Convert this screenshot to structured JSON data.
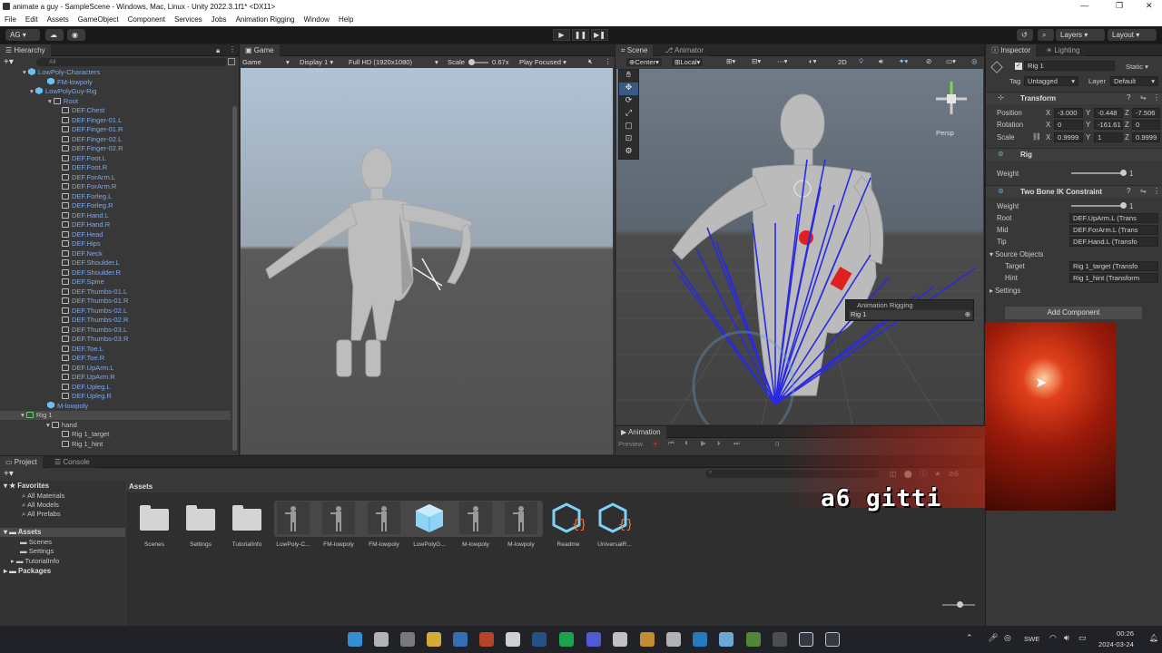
{
  "window": {
    "title": "animate a guy - SampleScene - Windows, Mac, Linux - Unity 2022.3.1f1* <DX11>",
    "controls": [
      "—",
      "❐",
      "✕"
    ]
  },
  "menu": [
    "File",
    "Edit",
    "Assets",
    "GameObject",
    "Component",
    "Services",
    "Jobs",
    "Animation Rigging",
    "Window",
    "Help"
  ],
  "toolbar": {
    "account": "AG",
    "layers": "Layers",
    "layout": "Layout"
  },
  "hierarchy": {
    "tab": "Hierarchy",
    "search": "All",
    "rows": [
      {
        "label": "LowPoly-Characters",
        "style": "blue"
      },
      {
        "label": "FM-lowpoly",
        "style": "blue"
      },
      {
        "label": "LowPolyGuy-Rig",
        "style": "blue"
      },
      {
        "label": "Root",
        "style": "blue"
      },
      {
        "label": "DEF.Chest",
        "style": "blue"
      },
      {
        "label": "DEF.Finger-01.L",
        "style": "blue"
      },
      {
        "label": "DEF.Finger-01.R",
        "style": "blue"
      },
      {
        "label": "DEF.Finger-02.L",
        "style": "blue"
      },
      {
        "label": "DEF.Finger-02.R",
        "style": "blue"
      },
      {
        "label": "DEF.Foot.L",
        "style": "blue"
      },
      {
        "label": "DEF.Foot.R",
        "style": "blue"
      },
      {
        "label": "DEF.ForArm.L",
        "style": "blue"
      },
      {
        "label": "DEF.ForArm.R",
        "style": "blue"
      },
      {
        "label": "DEF.Forleg.L",
        "style": "blue"
      },
      {
        "label": "DEF.Forleg.R",
        "style": "blue"
      },
      {
        "label": "DEF.Hand.L",
        "style": "blue"
      },
      {
        "label": "DEF.Hand.R",
        "style": "blue"
      },
      {
        "label": "DEF.Head",
        "style": "blue"
      },
      {
        "label": "DEF.Hips",
        "style": "blue"
      },
      {
        "label": "DEF.Neck",
        "style": "blue"
      },
      {
        "label": "DEF.Shoulder.L",
        "style": "blue"
      },
      {
        "label": "DEF.Shoulder.R",
        "style": "blue"
      },
      {
        "label": "DEF.Spine",
        "style": "blue"
      },
      {
        "label": "DEF.Thumbs-01.L",
        "style": "blue"
      },
      {
        "label": "DEF.Thumbs-01.R",
        "style": "blue"
      },
      {
        "label": "DEF.Thumbs-02.L",
        "style": "blue"
      },
      {
        "label": "DEF.Thumbs-02.R",
        "style": "blue"
      },
      {
        "label": "DEF.Thumbs-03.L",
        "style": "blue"
      },
      {
        "label": "DEF.Thumbs-03.R",
        "style": "blue"
      },
      {
        "label": "DEF.Toe.L",
        "style": "blue"
      },
      {
        "label": "DEF.Toe.R",
        "style": "blue"
      },
      {
        "label": "DEF.UpArm.L",
        "style": "blue"
      },
      {
        "label": "DEF.UpArm.R",
        "style": "blue"
      },
      {
        "label": "DEF.Upleg.L",
        "style": "blue"
      },
      {
        "label": "DEF.Upleg.R",
        "style": "blue"
      },
      {
        "label": "M-lowpoly",
        "style": "blue"
      },
      {
        "label": "Rig 1",
        "style": "selected"
      },
      {
        "label": "hand",
        "style": "plain"
      },
      {
        "label": "Rig 1_target",
        "style": "plain"
      },
      {
        "label": "Rig 1_hint",
        "style": "plain"
      }
    ]
  },
  "game": {
    "tab": "Game",
    "mode": "Game",
    "display": "Display 1",
    "resolution": "Full HD (1920x1080)",
    "scale_label": "Scale",
    "scale_value": "0.67x",
    "play_mode": "Play Focused"
  },
  "scene": {
    "tab_scene": "Scene",
    "tab_animator": "Animator",
    "pivot": "Center",
    "space": "Local",
    "mode2d": "2D",
    "persp": "Persp",
    "overlay_title": "Animation Rigging",
    "overlay_field": "Rig 1"
  },
  "animation": {
    "tab": "Animation",
    "preview": "Preview",
    "frame": "0"
  },
  "inspector": {
    "tab": "Inspector",
    "tab2": "Lighting",
    "object_name": "Rig 1",
    "static_label": "Static",
    "tag_label": "Tag",
    "tag_value": "Untagged",
    "layer_label": "Layer",
    "layer_value": "Default",
    "transform": {
      "title": "Transform",
      "position_label": "Position",
      "rotation_label": "Rotation",
      "scale_label": "Scale",
      "pos": {
        "x": "-3.000",
        "y": "-0.448",
        "z": "-7.506"
      },
      "rot": {
        "x": "0",
        "y": "-161.61",
        "z": "0"
      },
      "scale": {
        "x": "0.9999",
        "y": "1",
        "z": "0.9999"
      }
    },
    "rig": {
      "title": "Rig",
      "weight_label": "Weight",
      "weight": "1",
      "weight_fill": 1.0
    },
    "twobone": {
      "title": "Two Bone IK Constraint",
      "weight_label": "Weight",
      "weight": "1",
      "weight_fill": 1.0,
      "root_label": "Root",
      "root": "DEF.UpArm.L (Trans",
      "mid_label": "Mid",
      "mid": "DEF.ForArm.L (Trans",
      "tip_label": "Tip",
      "tip": "DEF.Hand.L (Transfo",
      "source_label": "Source Objects",
      "target_label": "Target",
      "target": "Rig 1_target (Transfo",
      "hint_label": "Hint",
      "hint": "Rig 1_hint (Transform",
      "settings_label": "Settings"
    },
    "add_component": "Add Component"
  },
  "project": {
    "tab": "Project",
    "tab2": "Console",
    "favorites_label": "Favorites",
    "favorites": [
      "All Materials",
      "All Models",
      "All Prefabs"
    ],
    "assets_label": "Assets",
    "asset_folders": [
      "Scenes",
      "Settings",
      "TutorialInfo"
    ],
    "packages_label": "Packages",
    "breadcrumb": "Assets",
    "items": [
      {
        "label": "Scenes",
        "kind": "folder"
      },
      {
        "label": "Settings",
        "kind": "folder"
      },
      {
        "label": "TutorialInfo",
        "kind": "folder"
      },
      {
        "label": "LowPoly-C...",
        "kind": "model"
      },
      {
        "label": "FM-lowpoly",
        "kind": "model"
      },
      {
        "label": "FM-lowpoly",
        "kind": "model"
      },
      {
        "label": "LowPolyG...",
        "kind": "prefab"
      },
      {
        "label": "M-lowpoly",
        "kind": "model"
      },
      {
        "label": "M-lowpoly",
        "kind": "model"
      },
      {
        "label": "Readme",
        "kind": "script"
      },
      {
        "label": "UniversalR...",
        "kind": "script"
      }
    ],
    "hidden_count": "6"
  },
  "overlay": {
    "caption": "a6 gitti"
  },
  "taskbar": {
    "lang": "SWE",
    "time": "00:26",
    "date": "2024-03-24"
  },
  "colors": {
    "accent": "#3a72b0",
    "hierarchy_blue": "#7fa8e8",
    "ik_lines": "#2a2ae0",
    "bg": "#383838"
  }
}
